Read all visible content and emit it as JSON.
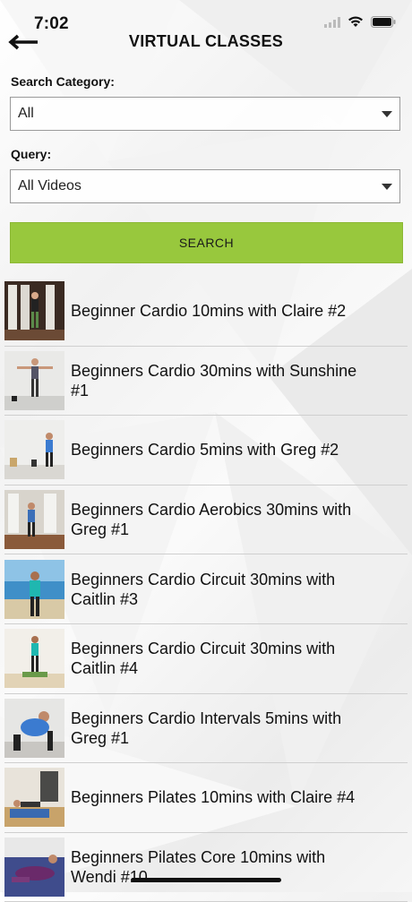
{
  "status": {
    "time": "7:02"
  },
  "header": {
    "title": "VIRTUAL CLASSES"
  },
  "form": {
    "category_label": "Search Category:",
    "category_value": "All",
    "query_label": "Query:",
    "query_value": "All Videos",
    "search_label": "SEARCH"
  },
  "videos": [
    {
      "title": "Beginner Cardio 10mins with Claire #2"
    },
    {
      "title": "Beginners Cardio 30mins with Sunshine #1"
    },
    {
      "title": "Beginners Cardio 5mins with Greg #2"
    },
    {
      "title": "Beginners Cardio Aerobics 30mins with Greg #1"
    },
    {
      "title": "Beginners Cardio Circuit 30mins with Caitlin #3"
    },
    {
      "title": "Beginners Cardio Circuit 30mins with Caitlin #4"
    },
    {
      "title": "Beginners Cardio Intervals 5mins with Greg #1"
    },
    {
      "title": "Beginners Pilates 10mins with Claire #4"
    },
    {
      "title": "Beginners Pilates Core 10mins with Wendi #10"
    }
  ],
  "colors": {
    "accent": "#98c83d"
  },
  "icons": [
    "back-arrow-icon",
    "wifi-icon",
    "battery-icon",
    "dropdown-arrow-icon"
  ]
}
